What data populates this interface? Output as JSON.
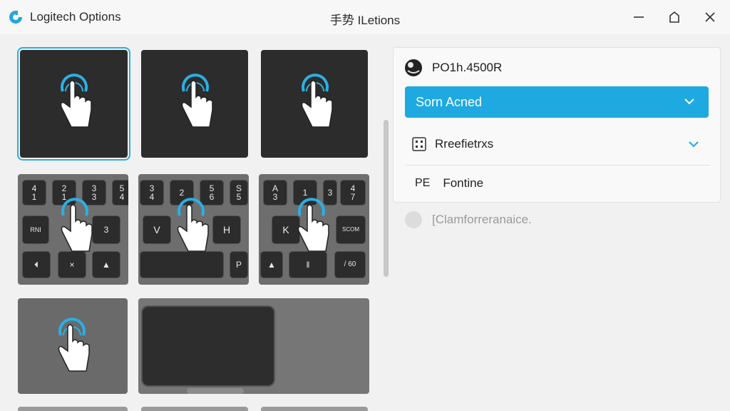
{
  "app": {
    "title": "Logitech Options",
    "window_title": "手势 ILetions",
    "accent": "#1ea9e1"
  },
  "window_controls": {
    "minimize_icon": "minimize-icon",
    "maximize_icon": "home-icon",
    "close_icon": "close-icon"
  },
  "tiles": {
    "keyboard_row1": {
      "keys": [
        [
          "4",
          "1"
        ],
        [
          "2",
          "1"
        ],
        [
          "3",
          "3"
        ],
        [
          "5",
          "4"
        ]
      ],
      "row2": [
        "RNI",
        "",
        "3"
      ],
      "row3": [
        "⏴",
        "×",
        "▲"
      ]
    },
    "keyboard_row2": {
      "keys": [
        [
          "3",
          "4"
        ],
        [
          "",
          "2"
        ],
        [
          "5",
          "6"
        ],
        [
          "S",
          "5"
        ]
      ],
      "row2": [
        "V",
        "",
        "H"
      ],
      "row3": [
        "",
        "",
        "P"
      ]
    },
    "keyboard_row3": {
      "keys": [
        [
          "A",
          "3"
        ],
        [
          "",
          "1"
        ],
        [
          "",
          "3"
        ],
        [
          "4",
          "7"
        ]
      ],
      "row2": [
        "K",
        "",
        "SCOM"
      ],
      "row3": [
        "▲",
        "‖",
        "/ 60"
      ]
    }
  },
  "panel": {
    "device_name": "PO1h.4500R",
    "dropdown_primary": "Sorn Acned",
    "row2_label": "Rreefietrxs",
    "row3_prefix": "PE",
    "row3_label": "Fontine"
  },
  "disabled_option": {
    "label": "[Clamforreranaice."
  }
}
